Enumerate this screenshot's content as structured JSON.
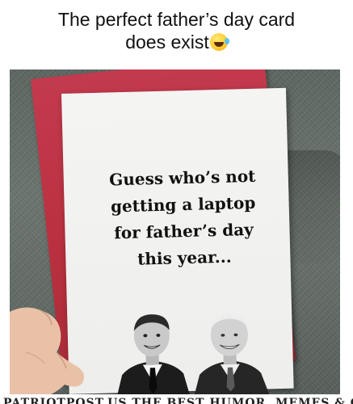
{
  "caption": {
    "line1": "The perfect father’s day card",
    "line2": "does exist"
  },
  "card": {
    "line1": "Guess who’s not",
    "line2": "getting a laptop",
    "line3": "for father’s day",
    "line4": "this year..."
  },
  "watermark": {
    "text": "PATRIOTPOST.US  THE BEST HUMOR, MEMES & CARTOONS"
  },
  "icons": {
    "caption_emoji": "rolling-on-floor-laughing-emoji-icon"
  },
  "colors": {
    "envelope": "#b8303f",
    "card": "#f2f2f0",
    "couch": "#636b66"
  }
}
